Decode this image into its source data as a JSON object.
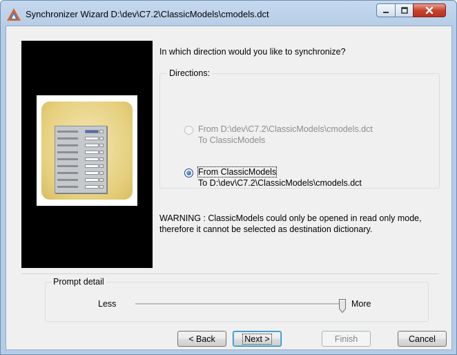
{
  "window": {
    "title": "Synchronizer Wizard D:\\dev\\C7.2\\ClassicModels\\cmodels.dct",
    "controls": {
      "minimize": "minimize-icon",
      "maximize": "maximize-icon",
      "close": "close-icon"
    }
  },
  "main": {
    "question": "In which direction would you like to synchronize?",
    "directions": {
      "legend": "Directions:",
      "options": [
        {
          "line1": "From D:\\dev\\C7.2\\ClassicModels\\cmodels.dct",
          "line2": "To ClassicModels",
          "selected": false,
          "enabled": false
        },
        {
          "line1": "From ClassicModels",
          "line2": "To D:\\dev\\C7.2\\ClassicModels\\cmodels.dct",
          "selected": true,
          "enabled": true
        }
      ]
    },
    "warning": {
      "line1": "WARNING : ClassicModels could only be opened in read only mode,",
      "line2": "therefore it cannot be selected as destination dictionary."
    }
  },
  "prompt": {
    "legend": "Prompt detail",
    "min_label": "Less",
    "max_label": "More",
    "level": 1.0
  },
  "buttons": {
    "back": "< Back",
    "next": "Next >",
    "finish": "Finish",
    "cancel": "Cancel"
  },
  "colors": {
    "accent": "#1a4e9c",
    "close_button": "#c7432f",
    "panel": "#000000"
  }
}
